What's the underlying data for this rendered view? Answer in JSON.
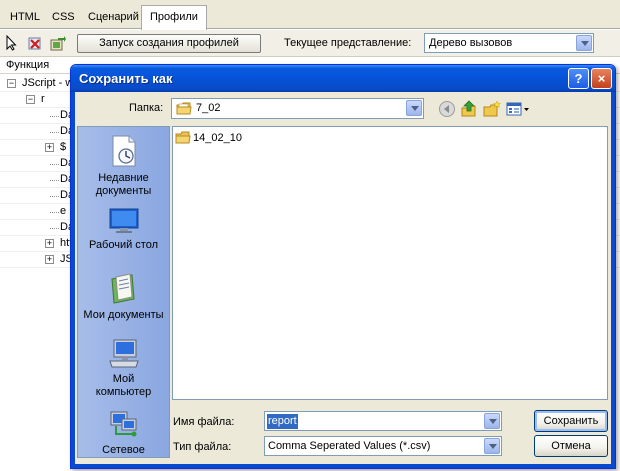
{
  "devtools": {
    "tabs": [
      "HTML",
      "CSS",
      "Сценарий",
      "Профили"
    ],
    "active_tab": "Профили",
    "run_button": "Запуск создания профилей",
    "view_label": "Текущее представление:",
    "view_value": "Дерево вызовов",
    "column_function": "Функция",
    "tree_rows": [
      "JScript - w",
      "r",
      "Da",
      "Da",
      "$",
      "Da",
      "Da",
      "Da",
      "e",
      "Da",
      "htt",
      "JS"
    ]
  },
  "dialog": {
    "title": "Сохранить как",
    "help_glyph": "?",
    "close_glyph": "×",
    "folder_label": "Папка:",
    "folder_value": "7_02",
    "places": [
      {
        "line1": "Недавние",
        "line2": "документы"
      },
      {
        "line1": "Рабочий стол",
        "line2": ""
      },
      {
        "line1": "Мои документы",
        "line2": ""
      },
      {
        "line1": "Мой",
        "line2": "компьютер"
      },
      {
        "line1": "Сетевое",
        "line2": ""
      }
    ],
    "files": [
      "14_02_10"
    ],
    "filename_label": "Имя файла:",
    "filename_value": "report",
    "filetype_label": "Тип файла:",
    "filetype_value": "Comma Seperated Values (*.csv)",
    "save_button": "Сохранить",
    "cancel_button": "Отмена"
  },
  "colors": {
    "titlebar": "#0552d7",
    "selection": "#316ac5",
    "places_bar": "#9db5e8"
  }
}
